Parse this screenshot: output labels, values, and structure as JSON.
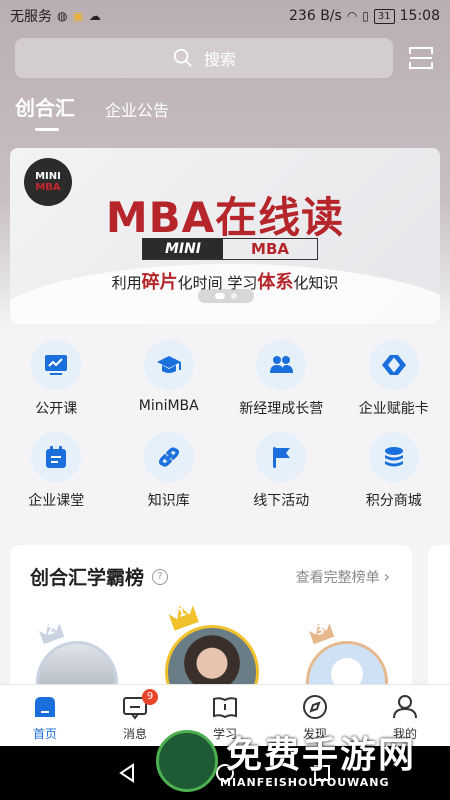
{
  "status_bar": {
    "carrier": "无服务",
    "speed": "236 B/s",
    "battery": "31",
    "time": "15:08"
  },
  "search": {
    "placeholder": "搜索"
  },
  "top_tabs": [
    {
      "label": "创合汇",
      "active": true
    },
    {
      "label": "企业公告",
      "active": false
    }
  ],
  "banner": {
    "logo_line1": "MINI",
    "logo_line2": "MBA",
    "title": "MBA在线读",
    "bar_left": "MINI",
    "bar_right": "MBA",
    "sub_1": "利用",
    "sub_hl1": "碎片",
    "sub_2": "化时间  学习",
    "sub_hl2": "体系",
    "sub_3": "化知识"
  },
  "grid": [
    {
      "label": "公开课",
      "icon": "chart-screen-icon"
    },
    {
      "label": "MiniMBA",
      "icon": "graduation-cap-icon"
    },
    {
      "label": "新经理成长营",
      "icon": "users-icon"
    },
    {
      "label": "企业赋能卡",
      "icon": "cards-icon"
    },
    {
      "label": "企业课堂",
      "icon": "calendar-icon"
    },
    {
      "label": "知识库",
      "icon": "link-icon"
    },
    {
      "label": "线下活动",
      "icon": "flag-icon"
    },
    {
      "label": "积分商城",
      "icon": "coins-icon"
    }
  ],
  "leaderboard": {
    "title": "创合汇学霸榜",
    "more": "查看完整榜单",
    "ranks": [
      "1",
      "2",
      "3"
    ]
  },
  "bottom_nav": [
    {
      "label": "首页",
      "active": true
    },
    {
      "label": "消息",
      "badge": "9"
    },
    {
      "label": "学习"
    },
    {
      "label": "发现"
    },
    {
      "label": "我的"
    }
  ],
  "watermark": {
    "text": "免费手游网",
    "sub": "MIANFEISHOUYOUWANG"
  },
  "colors": {
    "accent": "#1a6fdc",
    "icon_bg": "#e6f0fb",
    "brand_red": "#b5252a",
    "badge": "#e8452c"
  }
}
